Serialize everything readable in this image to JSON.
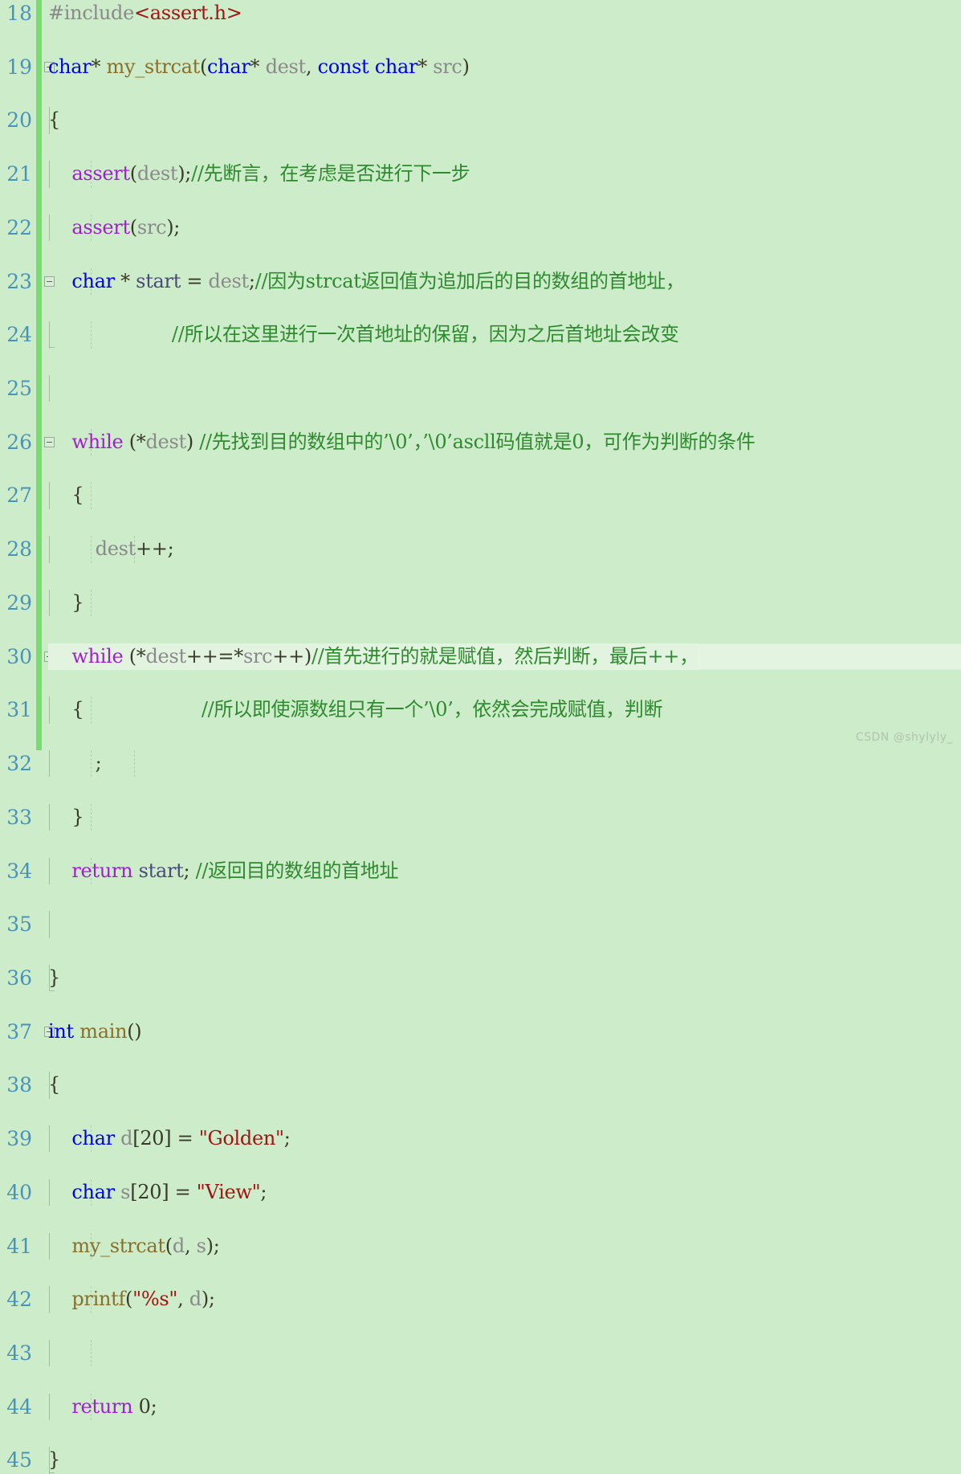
{
  "editor": {
    "watermark": "CSDN @shylyly_",
    "background_color": "#cdecca",
    "current_line_color": "#e3f4e1",
    "change_bar_color": "#77dd6e",
    "line_number_color": "#4a93b8",
    "first_line_number": 18,
    "last_line_number": 45,
    "current_line": 30,
    "colors": {
      "keyword_type": "#0000f0",
      "keyword_control": "#a020d0",
      "function": "#8a6f2a",
      "identifier": "#8a8a8a",
      "comment": "#2f8a2f",
      "string": "#a01414",
      "punctuation": "#3a3a28"
    }
  },
  "lines": [
    {
      "n": "18",
      "fold": "none",
      "indent": [],
      "tokens": [
        {
          "t": "#include",
          "c": "pp"
        },
        {
          "t": "<assert.h>",
          "c": "str"
        }
      ]
    },
    {
      "n": "19",
      "fold": "start",
      "indent": [],
      "tokens": [
        {
          "t": "char",
          "c": "k"
        },
        {
          "t": "* ",
          "c": "pn"
        },
        {
          "t": "my_strcat",
          "c": "fn"
        },
        {
          "t": "(",
          "c": "pn"
        },
        {
          "t": "char",
          "c": "k"
        },
        {
          "t": "* ",
          "c": "pn"
        },
        {
          "t": "dest",
          "c": "id"
        },
        {
          "t": ", ",
          "c": "pn"
        },
        {
          "t": "const",
          "c": "k"
        },
        {
          "t": " ",
          "c": "pn"
        },
        {
          "t": "char",
          "c": "k"
        },
        {
          "t": "* ",
          "c": "pn"
        },
        {
          "t": "src",
          "c": "id"
        },
        {
          "t": ")",
          "c": "pn"
        }
      ]
    },
    {
      "n": "20",
      "fold": "line",
      "indent": [],
      "tokens": [
        {
          "t": "{",
          "c": "pn"
        }
      ]
    },
    {
      "n": "21",
      "fold": "line",
      "indent": [
        1
      ],
      "tokens": [
        {
          "t": "    ",
          "c": "pn"
        },
        {
          "t": "assert",
          "c": "kw"
        },
        {
          "t": "(",
          "c": "pn"
        },
        {
          "t": "dest",
          "c": "id"
        },
        {
          "t": ");",
          "c": "pn"
        },
        {
          "t": "//先断言，在考虑是否进行下一步",
          "c": "cm"
        }
      ]
    },
    {
      "n": "22",
      "fold": "line",
      "indent": [
        1
      ],
      "tokens": [
        {
          "t": "    ",
          "c": "pn"
        },
        {
          "t": "assert",
          "c": "kw"
        },
        {
          "t": "(",
          "c": "pn"
        },
        {
          "t": "src",
          "c": "id"
        },
        {
          "t": ");",
          "c": "pn"
        }
      ]
    },
    {
      "n": "23",
      "fold": "start",
      "indent": [
        1
      ],
      "tokens": [
        {
          "t": "    ",
          "c": "pn"
        },
        {
          "t": "char",
          "c": "k"
        },
        {
          "t": " * ",
          "c": "pn"
        },
        {
          "t": "start",
          "c": "var"
        },
        {
          "t": " = ",
          "c": "pn"
        },
        {
          "t": "dest",
          "c": "id"
        },
        {
          "t": ";",
          "c": "pn"
        },
        {
          "t": "//因为strcat返回值为追加后的目的数组的首地址，",
          "c": "cm"
        }
      ]
    },
    {
      "n": "24",
      "fold": "end",
      "indent": [
        1
      ],
      "tokens": [
        {
          "t": "                     ",
          "c": "pn"
        },
        {
          "t": "//所以在这里进行一次首地址的保留，因为之后首地址会改变",
          "c": "cm"
        }
      ]
    },
    {
      "n": "25",
      "fold": "line",
      "indent": [],
      "tokens": []
    },
    {
      "n": "26",
      "fold": "start",
      "indent": [
        1
      ],
      "tokens": [
        {
          "t": "    ",
          "c": "pn"
        },
        {
          "t": "while",
          "c": "kw"
        },
        {
          "t": " (*",
          "c": "pn"
        },
        {
          "t": "dest",
          "c": "id"
        },
        {
          "t": ") ",
          "c": "pn"
        },
        {
          "t": "//先找到目的数组中的’\\0’，’\\0’ascll码值就是0，可作为判断的条件",
          "c": "cm"
        }
      ]
    },
    {
      "n": "27",
      "fold": "line",
      "indent": [
        1
      ],
      "tokens": [
        {
          "t": "    {",
          "c": "pn"
        }
      ]
    },
    {
      "n": "28",
      "fold": "line",
      "indent": [
        1,
        2
      ],
      "tokens": [
        {
          "t": "        ",
          "c": "pn"
        },
        {
          "t": "dest",
          "c": "id"
        },
        {
          "t": "++;",
          "c": "pn"
        }
      ]
    },
    {
      "n": "29",
      "fold": "line",
      "indent": [
        1
      ],
      "tokens": [
        {
          "t": "    }",
          "c": "pn"
        }
      ]
    },
    {
      "n": "30",
      "fold": "start",
      "indent": [
        1
      ],
      "current": true,
      "tokens": [
        {
          "t": "    ",
          "c": "pn"
        },
        {
          "t": "while",
          "c": "kw"
        },
        {
          "t": " (*",
          "c": "pn"
        },
        {
          "t": "dest",
          "c": "id"
        },
        {
          "t": "++=*",
          "c": "pn"
        },
        {
          "t": "src",
          "c": "id"
        },
        {
          "t": "++)",
          "c": "pn"
        },
        {
          "t": "//首先进行的就是赋值，然后判断，最后++，",
          "c": "cm"
        }
      ]
    },
    {
      "n": "31",
      "fold": "line",
      "indent": [
        1
      ],
      "tokens": [
        {
          "t": "    {",
          "c": "pn"
        },
        {
          "t": "                    ",
          "c": "pn"
        },
        {
          "t": "//所以即使源数组只有一个’\\0’，依然会完成赋值，判断",
          "c": "cm"
        }
      ]
    },
    {
      "n": "32",
      "fold": "line",
      "indent": [
        1,
        2
      ],
      "tokens": [
        {
          "t": "        ;",
          "c": "pn"
        }
      ]
    },
    {
      "n": "33",
      "fold": "line",
      "indent": [
        1
      ],
      "tokens": [
        {
          "t": "    }",
          "c": "pn"
        }
      ]
    },
    {
      "n": "34",
      "fold": "line",
      "indent": [
        1
      ],
      "tokens": [
        {
          "t": "    ",
          "c": "pn"
        },
        {
          "t": "return",
          "c": "kw"
        },
        {
          "t": " ",
          "c": "pn"
        },
        {
          "t": "start",
          "c": "var"
        },
        {
          "t": "; ",
          "c": "pn"
        },
        {
          "t": "//返回目的数组的首地址",
          "c": "cm"
        }
      ]
    },
    {
      "n": "35",
      "fold": "line",
      "indent": [],
      "tokens": []
    },
    {
      "n": "36",
      "fold": "end",
      "indent": [],
      "tokens": [
        {
          "t": "}",
          "c": "pn"
        }
      ]
    },
    {
      "n": "37",
      "fold": "start",
      "indent": [],
      "tokens": [
        {
          "t": "int",
          "c": "k"
        },
        {
          "t": " ",
          "c": "pn"
        },
        {
          "t": "main",
          "c": "fn"
        },
        {
          "t": "()",
          "c": "pn"
        }
      ]
    },
    {
      "n": "38",
      "fold": "line",
      "indent": [],
      "tokens": [
        {
          "t": "{",
          "c": "pn"
        }
      ]
    },
    {
      "n": "39",
      "fold": "line",
      "indent": [
        1
      ],
      "tokens": [
        {
          "t": "    ",
          "c": "pn"
        },
        {
          "t": "char",
          "c": "k"
        },
        {
          "t": " ",
          "c": "pn"
        },
        {
          "t": "d",
          "c": "id"
        },
        {
          "t": "[",
          "c": "pn"
        },
        {
          "t": "20",
          "c": "num"
        },
        {
          "t": "] = ",
          "c": "pn"
        },
        {
          "t": "\"Golden\"",
          "c": "str"
        },
        {
          "t": ";",
          "c": "pn"
        }
      ]
    },
    {
      "n": "40",
      "fold": "line",
      "indent": [
        1
      ],
      "tokens": [
        {
          "t": "    ",
          "c": "pn"
        },
        {
          "t": "char",
          "c": "k"
        },
        {
          "t": " ",
          "c": "pn"
        },
        {
          "t": "s",
          "c": "id"
        },
        {
          "t": "[",
          "c": "pn"
        },
        {
          "t": "20",
          "c": "num"
        },
        {
          "t": "] = ",
          "c": "pn"
        },
        {
          "t": "\"View\"",
          "c": "str"
        },
        {
          "t": ";",
          "c": "pn"
        }
      ]
    },
    {
      "n": "41",
      "fold": "line",
      "indent": [
        1
      ],
      "tokens": [
        {
          "t": "    ",
          "c": "pn"
        },
        {
          "t": "my_strcat",
          "c": "fn"
        },
        {
          "t": "(",
          "c": "pn"
        },
        {
          "t": "d",
          "c": "id"
        },
        {
          "t": ", ",
          "c": "pn"
        },
        {
          "t": "s",
          "c": "id"
        },
        {
          "t": ");",
          "c": "pn"
        }
      ]
    },
    {
      "n": "42",
      "fold": "line",
      "indent": [
        1
      ],
      "tokens": [
        {
          "t": "    ",
          "c": "pn"
        },
        {
          "t": "printf",
          "c": "fn"
        },
        {
          "t": "(",
          "c": "pn"
        },
        {
          "t": "\"%s\"",
          "c": "str"
        },
        {
          "t": ", ",
          "c": "pn"
        },
        {
          "t": "d",
          "c": "id"
        },
        {
          "t": ");",
          "c": "pn"
        }
      ]
    },
    {
      "n": "43",
      "fold": "line",
      "indent": [
        1
      ],
      "tokens": []
    },
    {
      "n": "44",
      "fold": "line",
      "indent": [
        1
      ],
      "tokens": [
        {
          "t": "    ",
          "c": "pn"
        },
        {
          "t": "return",
          "c": "kw"
        },
        {
          "t": " ",
          "c": "pn"
        },
        {
          "t": "0",
          "c": "num"
        },
        {
          "t": ";",
          "c": "pn"
        }
      ]
    },
    {
      "n": "45",
      "fold": "end",
      "indent": [],
      "tokens": [
        {
          "t": "}",
          "c": "pn"
        }
      ]
    }
  ]
}
